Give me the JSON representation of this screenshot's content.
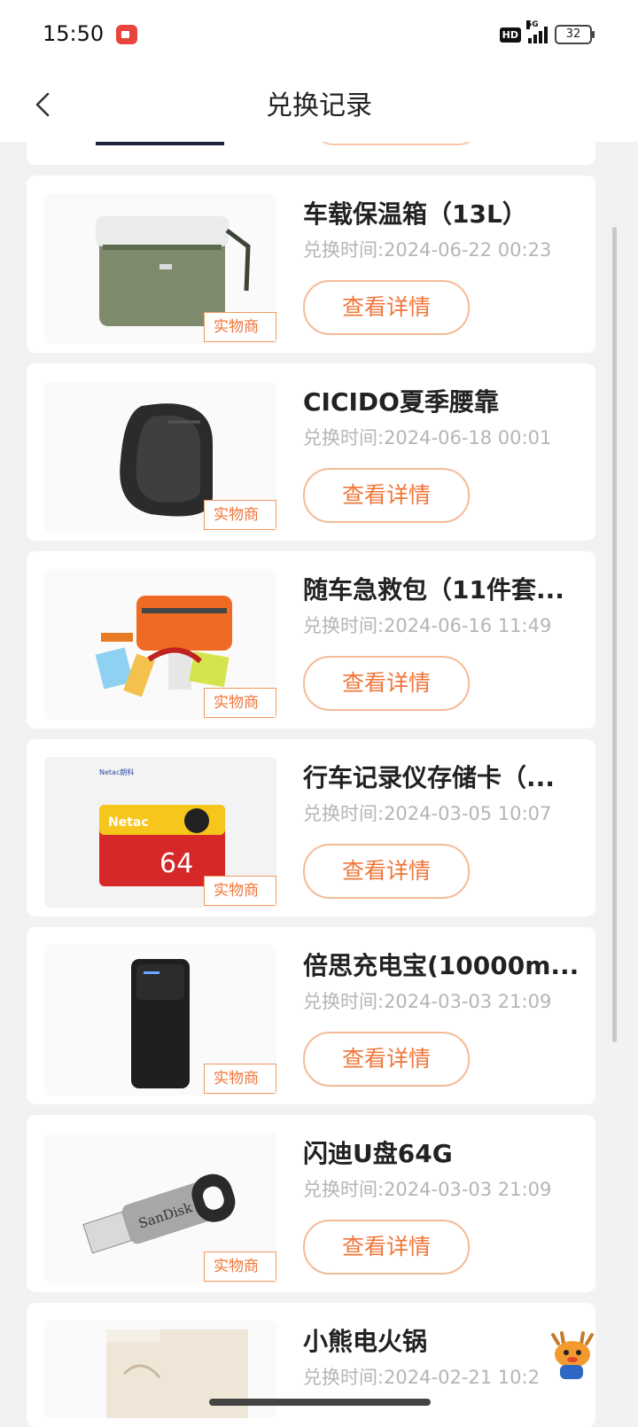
{
  "status_bar": {
    "time": "15:50",
    "battery": "32",
    "network": "5G",
    "hd": "HD"
  },
  "header": {
    "title": "兑换记录",
    "back_icon": "chevron-left-icon"
  },
  "items": [
    {
      "name": "车载保温箱（13L）",
      "date": "兑换时间:2024-06-22 00:23",
      "tag": "实物商品",
      "button": "查看详情",
      "image": "cooler-box"
    },
    {
      "name": "CICIDO夏季腰靠",
      "date": "兑换时间:2024-06-18 00:01",
      "tag": "实物商品",
      "button": "查看详情",
      "image": "lumbar-pillow"
    },
    {
      "name": "随车急救包（11件套...",
      "date": "兑换时间:2024-06-16 11:49",
      "tag": "实物商品",
      "button": "查看详情",
      "image": "first-aid-kit"
    },
    {
      "name": "行车记录仪存储卡（...",
      "date": "兑换时间:2024-03-05 10:07",
      "tag": "实物商品",
      "button": "查看详情",
      "image": "memory-card",
      "image_text": [
        "Netac朗科",
        "Netac",
        "64"
      ]
    },
    {
      "name": "倍思充电宝(10000m...",
      "date": "兑换时间:2024-03-03 21:09",
      "tag": "实物商品",
      "button": "查看详情",
      "image": "power-bank"
    },
    {
      "name": "闪迪U盘64G",
      "date": "兑换时间:2024-03-03 21:09",
      "tag": "实物商品",
      "button": "查看详情",
      "image": "usb-drive",
      "image_text": [
        "SanDisk"
      ]
    },
    {
      "name": "小熊电火锅",
      "date": "兑换时间:2024-02-21 10:2",
      "tag": "",
      "button": "",
      "image": "hot-pot"
    }
  ],
  "colors": {
    "accent": "#f0763a",
    "background": "#f2f2f2",
    "card": "#ffffff"
  }
}
